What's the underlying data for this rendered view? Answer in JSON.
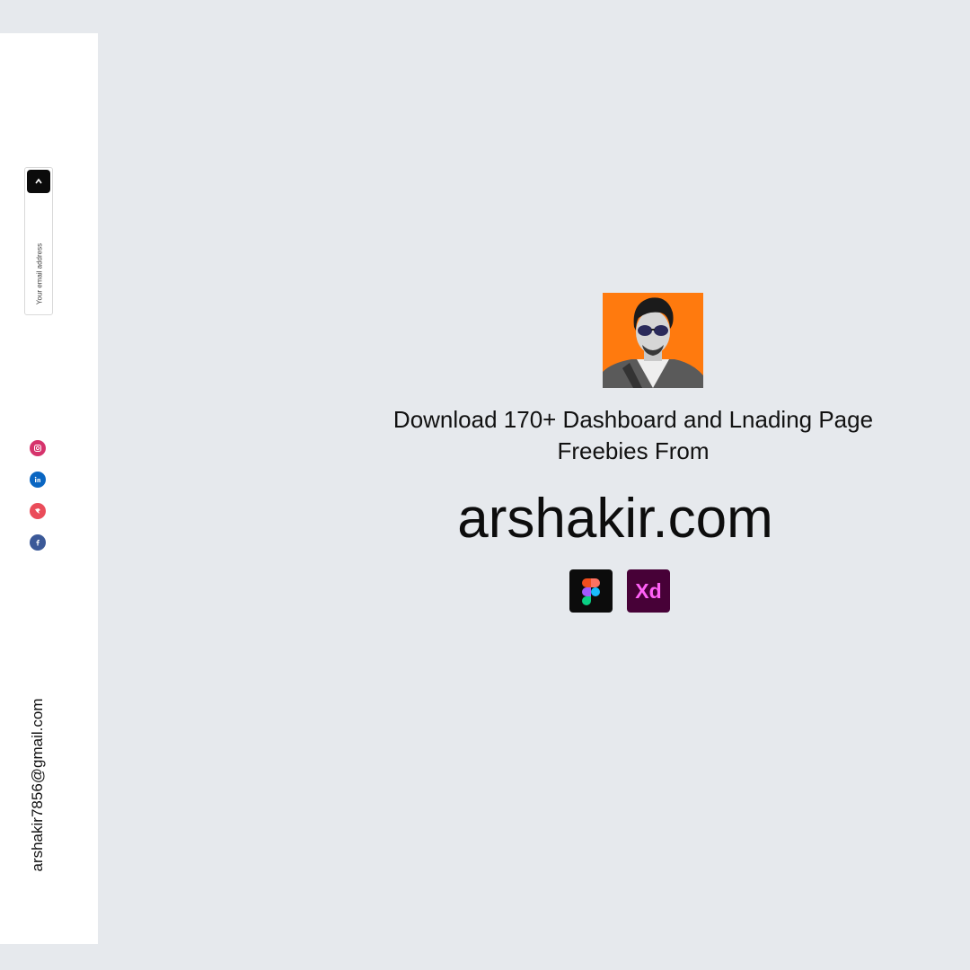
{
  "sidebar": {
    "email_placeholder": "Your email address",
    "submit_icon": "arrow-up-icon",
    "socials": [
      {
        "name": "instagram",
        "icon": "instagram-icon",
        "color": "#d6336c"
      },
      {
        "name": "linkedin",
        "icon": "linkedin-icon",
        "color": "#0a66c2"
      },
      {
        "name": "dribbble",
        "icon": "bird-icon",
        "color": "#ea4c5a"
      },
      {
        "name": "facebook",
        "icon": "facebook-icon",
        "color": "#3b5998"
      }
    ],
    "contact_email": "arshakir7856@gmail.com"
  },
  "main": {
    "headline_line1": "Download 170+ Dashboard and Lnading Page",
    "headline_line2": "Freebies From",
    "site": "arshakir.com",
    "tools": [
      {
        "name": "Figma",
        "icon": "figma-icon"
      },
      {
        "name": "Xd",
        "icon": "adobe-xd-icon",
        "label": "Xd"
      }
    ]
  },
  "colors": {
    "background": "#e6e9ed",
    "sidebar": "#ffffff",
    "avatar_bg": "#ff7a0e",
    "xd_bg": "#470137",
    "xd_text": "#ff61f6"
  }
}
